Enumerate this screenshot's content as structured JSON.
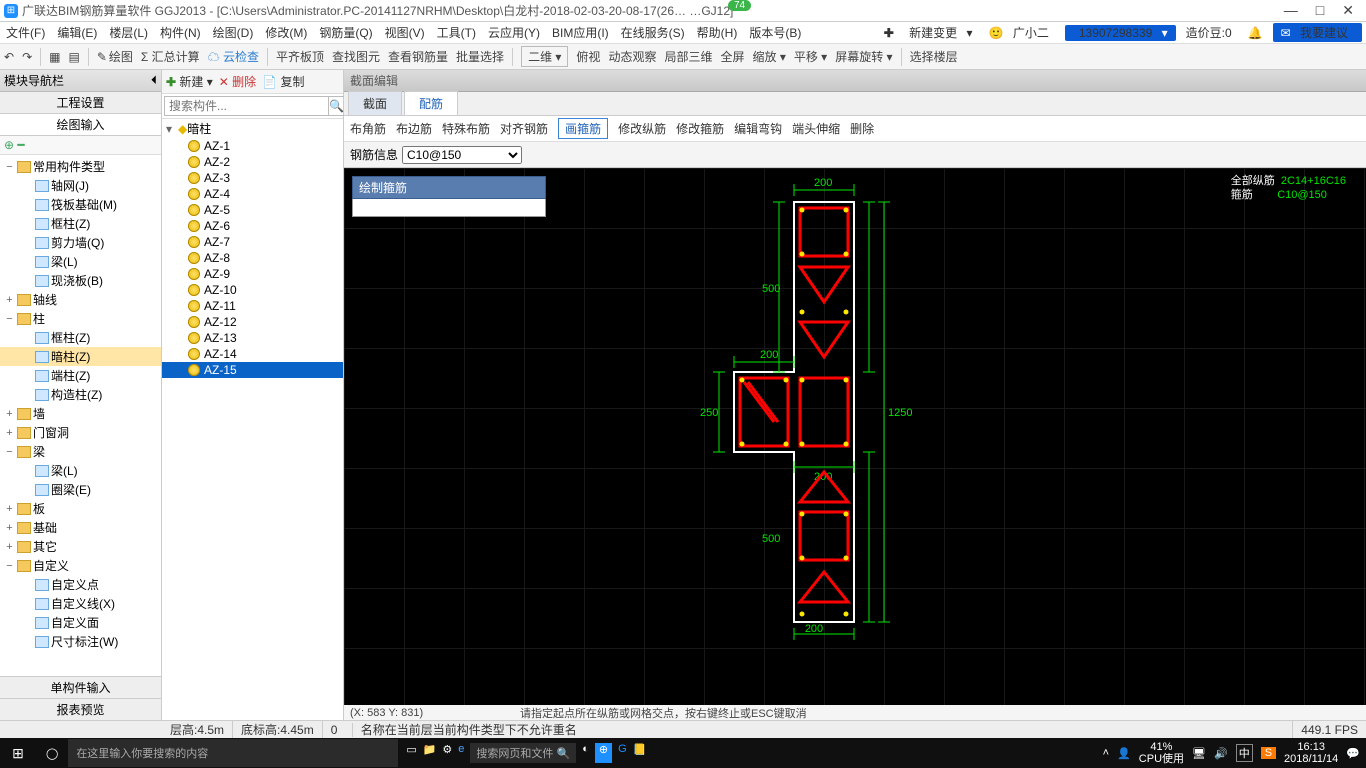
{
  "title": "广联达BIM钢筋算量软件 GGJ2013 - [C:\\Users\\Administrator.PC-20141127NRHM\\Desktop\\白龙村-2018-02-03-20-08-17(26… …GJ12]",
  "badge": "74",
  "winbtns": {
    "min": "—",
    "max": "□",
    "close": "✕"
  },
  "menu": [
    "文件(F)",
    "编辑(E)",
    "楼层(L)",
    "构件(N)",
    "绘图(D)",
    "修改(M)",
    "钢筋量(Q)",
    "视图(V)",
    "工具(T)",
    "云应用(Y)",
    "BIM应用(I)",
    "在线服务(S)",
    "帮助(H)",
    "版本号(B)"
  ],
  "menu_right": {
    "new_change": "新建变更",
    "avatar": "广小二",
    "phone": "13907298339",
    "price": "造价豆:0",
    "feedback": "我要建议"
  },
  "toolbar": [
    "↶",
    "↷",
    "▦",
    "▤",
    "绘图",
    "Σ 汇总计算",
    "☁ 云检查",
    "平齐板顶",
    "查找图元",
    "查看钢筋量",
    "批量选择",
    "二维 ▾",
    "俯视",
    "动态观察",
    "局部三维",
    "全屏",
    "缩放 ▾",
    "平移 ▾",
    "屏幕旋转 ▾",
    "选择楼层"
  ],
  "leftpanel": {
    "title": "模块导航栏",
    "sub1": "工程设置",
    "sub2": "绘图输入",
    "smallicons": "⊕ ━",
    "bottom1": "单构件输入",
    "bottom2": "报表预览"
  },
  "tree": [
    {
      "ind": 0,
      "t": "−",
      "f": "folder",
      "label": "常用构件类型"
    },
    {
      "ind": 1,
      "t": "",
      "f": "comp",
      "label": "轴网(J)"
    },
    {
      "ind": 1,
      "t": "",
      "f": "comp",
      "label": "筏板基础(M)"
    },
    {
      "ind": 1,
      "t": "",
      "f": "comp",
      "label": "框柱(Z)"
    },
    {
      "ind": 1,
      "t": "",
      "f": "comp",
      "label": "剪力墙(Q)"
    },
    {
      "ind": 1,
      "t": "",
      "f": "comp",
      "label": "梁(L)"
    },
    {
      "ind": 1,
      "t": "",
      "f": "comp",
      "label": "现浇板(B)"
    },
    {
      "ind": 0,
      "t": "+",
      "f": "folder",
      "label": "轴线"
    },
    {
      "ind": 0,
      "t": "−",
      "f": "folder",
      "label": "柱"
    },
    {
      "ind": 1,
      "t": "",
      "f": "comp",
      "label": "框柱(Z)"
    },
    {
      "ind": 1,
      "t": "",
      "f": "comp",
      "label": "暗柱(Z)",
      "sel": true
    },
    {
      "ind": 1,
      "t": "",
      "f": "comp",
      "label": "端柱(Z)"
    },
    {
      "ind": 1,
      "t": "",
      "f": "comp",
      "label": "构造柱(Z)"
    },
    {
      "ind": 0,
      "t": "+",
      "f": "folder",
      "label": "墙"
    },
    {
      "ind": 0,
      "t": "+",
      "f": "folder",
      "label": "门窗洞"
    },
    {
      "ind": 0,
      "t": "−",
      "f": "folder",
      "label": "梁"
    },
    {
      "ind": 1,
      "t": "",
      "f": "comp",
      "label": "梁(L)"
    },
    {
      "ind": 1,
      "t": "",
      "f": "comp",
      "label": "圈梁(E)"
    },
    {
      "ind": 0,
      "t": "+",
      "f": "folder",
      "label": "板"
    },
    {
      "ind": 0,
      "t": "+",
      "f": "folder",
      "label": "基础"
    },
    {
      "ind": 0,
      "t": "+",
      "f": "folder",
      "label": "其它"
    },
    {
      "ind": 0,
      "t": "−",
      "f": "folder",
      "label": "自定义"
    },
    {
      "ind": 1,
      "t": "",
      "f": "comp",
      "label": "自定义点"
    },
    {
      "ind": 1,
      "t": "",
      "f": "comp",
      "label": "自定义线(X)"
    },
    {
      "ind": 1,
      "t": "",
      "f": "comp",
      "label": "自定义面"
    },
    {
      "ind": 1,
      "t": "",
      "f": "comp",
      "label": "尺寸标注(W)"
    }
  ],
  "listtool": {
    "new": "新建",
    "del": "✕ 删除",
    "copy": "复制"
  },
  "search_placeholder": "搜索构件...",
  "list_group": "暗柱",
  "list_items": [
    "AZ-1",
    "AZ-2",
    "AZ-3",
    "AZ-4",
    "AZ-5",
    "AZ-6",
    "AZ-7",
    "AZ-8",
    "AZ-9",
    "AZ-10",
    "AZ-11",
    "AZ-12",
    "AZ-13",
    "AZ-14",
    "AZ-15"
  ],
  "list_selected": "AZ-15",
  "canvas_head": "截面编辑",
  "canvas_tabs": {
    "t1": "截面",
    "t2": "配筋"
  },
  "subtool": [
    "布角筋",
    "布边筋",
    "特殊布筋",
    "对齐钢筋",
    "画箍筋",
    "修改纵筋",
    "修改箍筋",
    "编辑弯钩",
    "端头伸缩",
    "删除"
  ],
  "subtool_boxed": "画箍筋",
  "rebar_label": "钢筋信息",
  "rebar_value": "C10@150",
  "dropdown_head": "绘制箍筋",
  "annot": {
    "a": "全部纵筋",
    "b": "箍筋",
    "c": "2C14+16C16",
    "d": "C10@150"
  },
  "dims": {
    "d200": "200",
    "d500": "500",
    "d250": "250",
    "d1250": "1250"
  },
  "status": {
    "layer": "层高:4.5m",
    "bottom": "底标高:4.45m",
    "zero": "0",
    "coord": "(X: 583 Y: 831)",
    "hint": "请指定起点所在纵筋或网格交点，按右键终止或ESC键取消",
    "err": "名称在当前层当前构件类型下不允许重名",
    "fps": "449.1 FPS"
  },
  "taskbar": {
    "search": "在这里输入你要搜索的内容",
    "cpu_pct": "41%",
    "cpu_lbl": "CPU使用",
    "time": "16:13",
    "date": "2018/11/14"
  }
}
